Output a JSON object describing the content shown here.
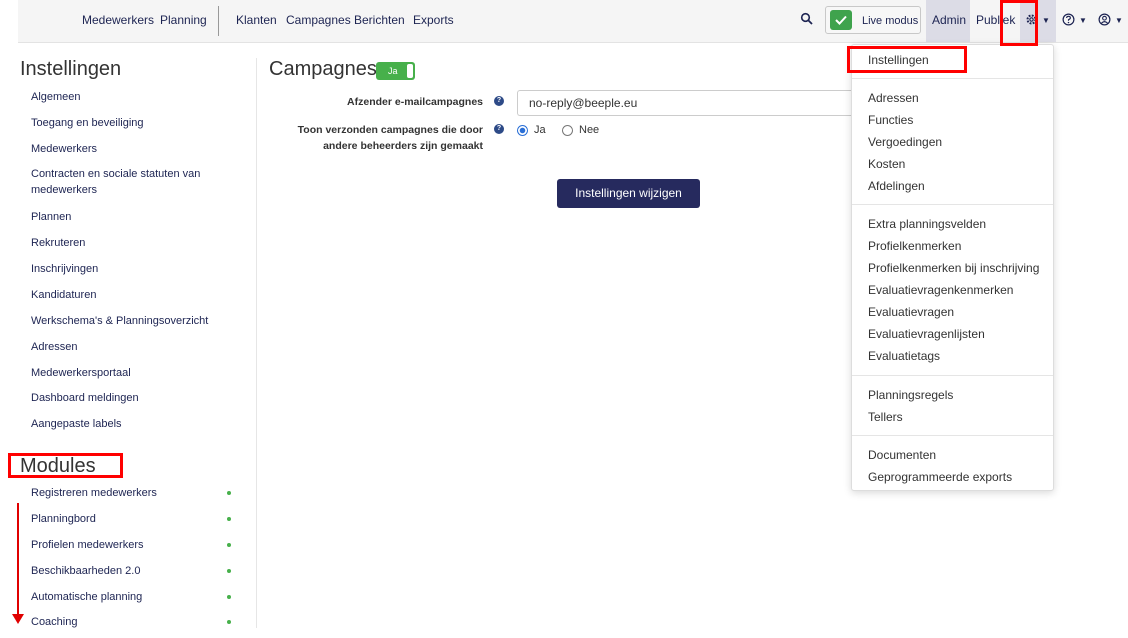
{
  "topnav": {
    "links_left": [
      "Medewerkers",
      "Planning"
    ],
    "links_main": [
      "Klanten",
      "Campagnes",
      "Berichten",
      "Exports"
    ],
    "live_mode": "Live modus",
    "admin": "Admin",
    "public": "Publiek"
  },
  "sidebar": {
    "title": "Instellingen",
    "items": [
      "Algemeen",
      "Toegang en beveiliging",
      "Medewerkers",
      "Contracten en sociale statuten van medewerkers",
      "Plannen",
      "Rekruteren",
      "Inschrijvingen",
      "Kandidaturen",
      "Werkschema's & Planningsoverzicht",
      "Adressen",
      "Medewerkersportaal",
      "Dashboard meldingen",
      "Aangepaste labels"
    ],
    "modules_title": "Modules",
    "modules": [
      "Registreren medewerkers",
      "Planningbord",
      "Profielen medewerkers",
      "Beschikbaarheden 2.0",
      "Automatische planning",
      "Coaching"
    ]
  },
  "main": {
    "title": "Campagnes",
    "toggle_label": "Ja",
    "sender_label": "Afzender e-mailcampagnes",
    "sender_value": "no-reply@beeple.eu",
    "show_sent_label_1": "Toon verzonden campagnes die door",
    "show_sent_label_2": "andere beheerders zijn gemaakt",
    "radio_yes": "Ja",
    "radio_no": "Nee",
    "submit": "Instellingen wijzigen"
  },
  "dropdown": {
    "groups": [
      [
        "Instellingen"
      ],
      [
        "Adressen",
        "Functies",
        "Vergoedingen",
        "Kosten",
        "Afdelingen"
      ],
      [
        "Extra planningsvelden",
        "Profielkenmerken",
        "Profielkenmerken bij inschrijving",
        "Evaluatievragenkenmerken",
        "Evaluatievragen",
        "Evaluatievragenlijsten",
        "Evaluatietags"
      ],
      [
        "Planningsregels",
        "Tellers"
      ],
      [
        "Documenten",
        "Geprogrammeerde exports"
      ]
    ]
  },
  "colors": {
    "brand_navy": "#262a5e",
    "success_green": "#47b04b",
    "annotation_red": "#ff0000"
  }
}
